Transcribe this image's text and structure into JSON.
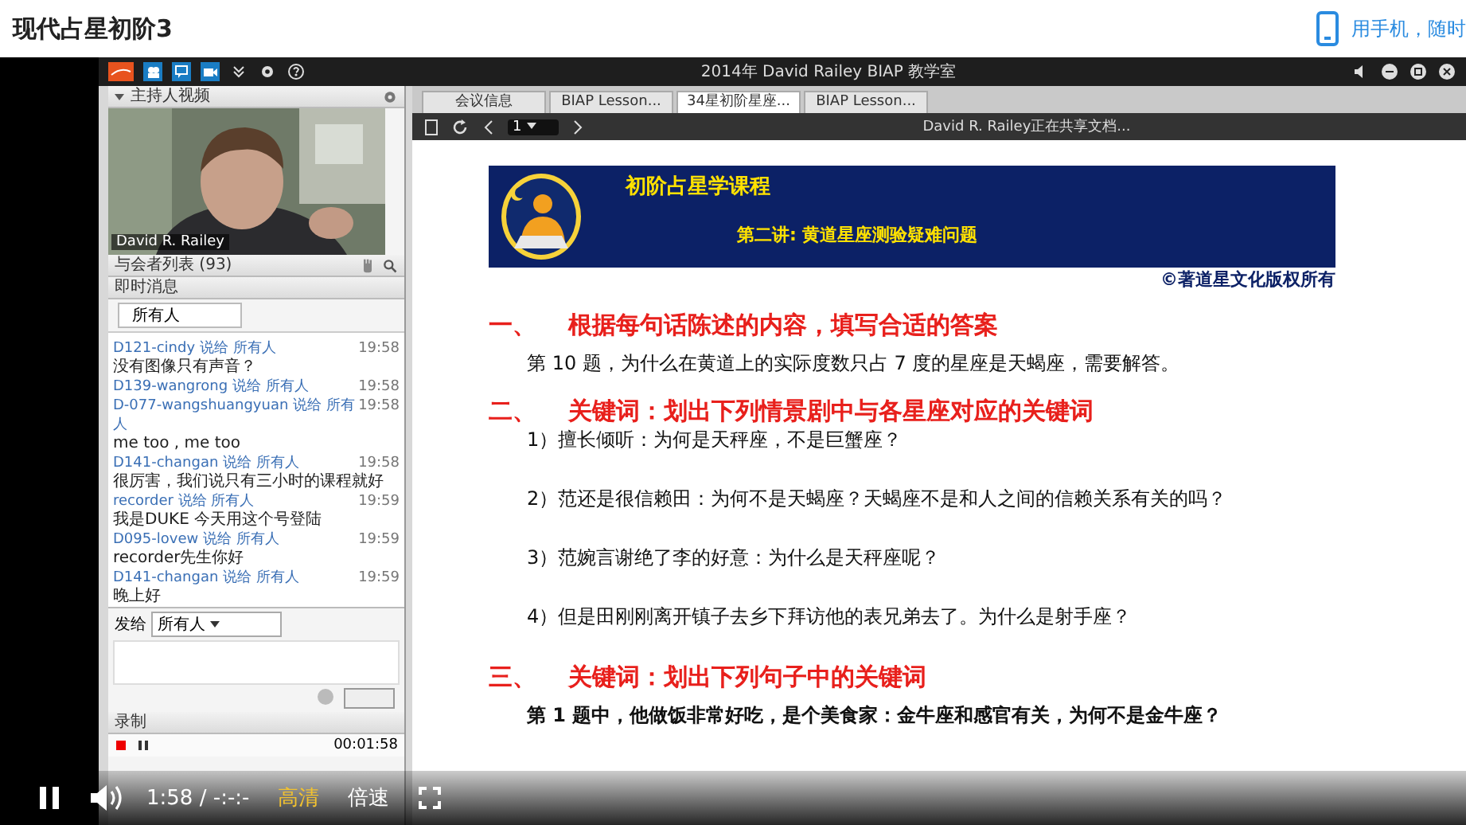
{
  "page": {
    "title": "现代占星初阶3",
    "mobile_link": "用手机，随时"
  },
  "app": {
    "title": "2014年 David Railey BIAP 教学室",
    "host_video": {
      "title": "主持人视频",
      "name_tag": "David R. Railey",
      "kind": "picture"
    },
    "attendees": {
      "title": "与会者列表 (93)"
    },
    "chat": {
      "title": "即时消息",
      "filter": "所有人",
      "messages": [
        {
          "sender": "D121-cindy 说给 所有人",
          "time": "19:58",
          "text": "没有图像只有声音？"
        },
        {
          "sender": "D139-wangrong 说给 所有人",
          "time": "19:58"
        },
        {
          "sender": "D-077-wangshuangyuan 说给 所有人",
          "time": "19:58",
          "text": "me too , me too"
        },
        {
          "sender": "D141-changan 说给 所有人",
          "time": "19:58",
          "text": "很厉害，我们说只有三小时的课程就好"
        },
        {
          "sender": "recorder 说给 所有人",
          "time": "19:59",
          "text": "我是DUKE 今天用这个号登陆"
        },
        {
          "sender": "D095-lovew 说给 所有人",
          "time": "19:59",
          "text": "recorder先生你好"
        },
        {
          "sender": "D141-changan 说给 所有人",
          "time": "19:59",
          "text": "晚上好"
        }
      ],
      "send_to_label": "发给",
      "send_to": "所有人"
    },
    "recording": {
      "title": "录制",
      "time": "00:01:58"
    },
    "tabs": [
      {
        "label": "会议信息",
        "selected": false
      },
      {
        "label": "BIAP Lesson...",
        "selected": false
      },
      {
        "label": "34星初阶星座...",
        "selected": true
      },
      {
        "label": "BIAP Lesson...",
        "selected": false
      }
    ],
    "page_select": "1",
    "status": "David R. Railey正在共享文档...",
    "slide": {
      "title": "初阶占星学课程",
      "subtitle": "第二讲: 黄道星座测验疑难问题",
      "copyright": "©著道星文化版权所有",
      "sections": [
        {
          "number": "一、",
          "heading": "根据每句话陈述的内容，填写合适的答案",
          "items": [
            "第 10 题，为什么在黄道上的实际度数只占 7 度的星座是天蝎座，需要解答。"
          ]
        },
        {
          "number": "二、",
          "heading": "关键词：划出下列情景剧中与各星座对应的关键词",
          "items": [
            "1）擅长倾听：为何是天秤座，不是巨蟹座？",
            "2）范还是很信赖田：为何不是天蝎座？天蝎座不是和人之间的信赖关系有关的吗？",
            "3）范婉言谢绝了李的好意：为什么是天秤座呢？",
            "4）但是田刚刚离开镇子去乡下拜访他的表兄弟去了。为什么是射手座？"
          ]
        },
        {
          "number": "三、",
          "heading": "关键词：划出下列句子中的关键词",
          "items": [
            "第 1 题中，他做饭非常好吃，是个美食家：金牛座和感官有关，为何不是金牛座？"
          ]
        }
      ]
    }
  },
  "player": {
    "playing": true,
    "time": "1:58",
    "separator": "/",
    "duration": "-:-:-",
    "quality": "高清",
    "speed": "倍速"
  }
}
